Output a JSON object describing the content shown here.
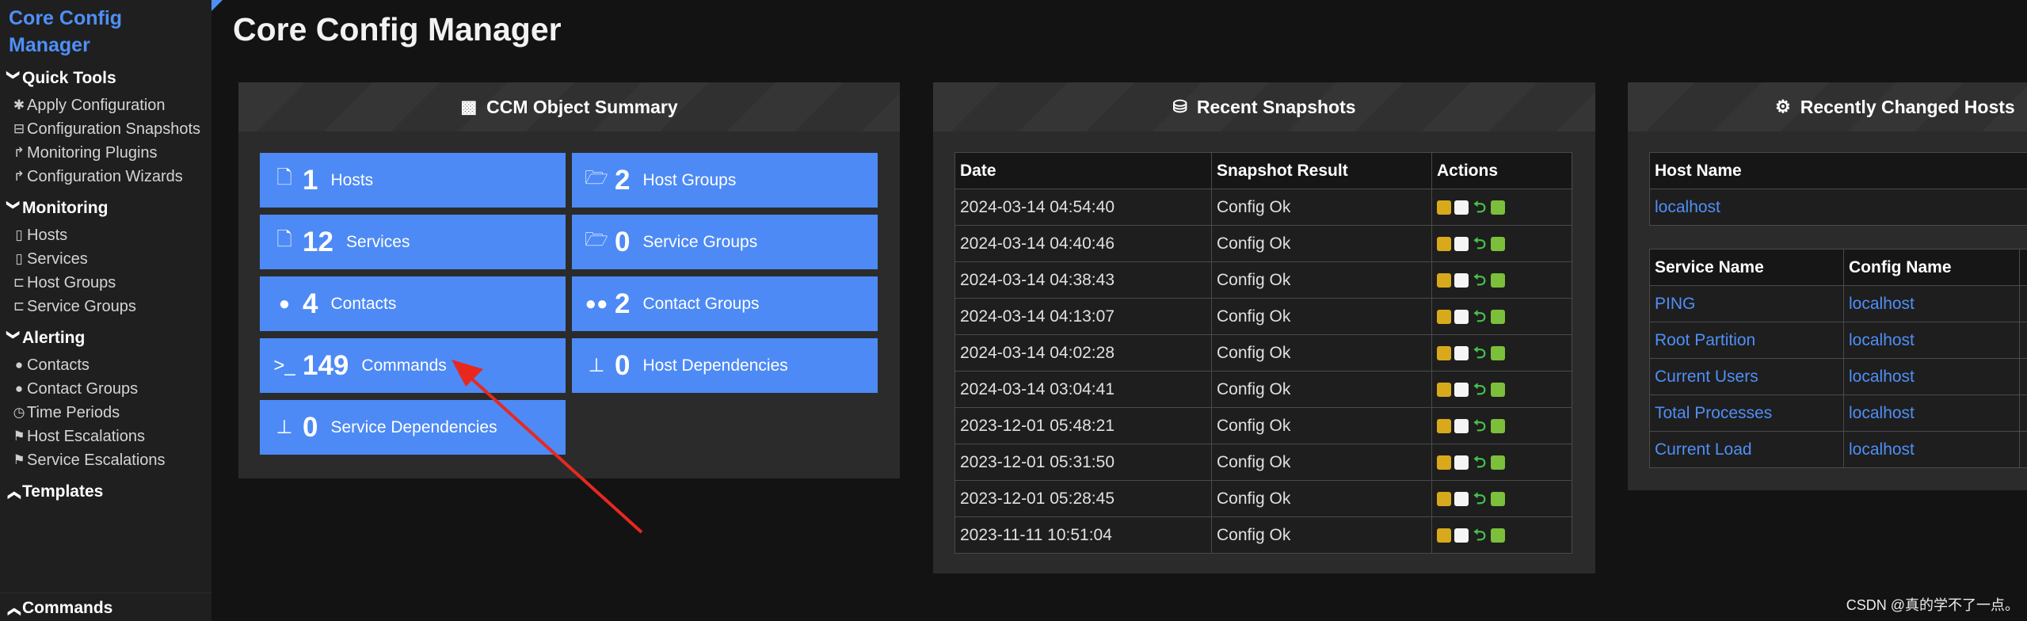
{
  "app": {
    "title_line1": "Core Config",
    "title_line2": "Manager"
  },
  "sidebar": {
    "quick_tools": {
      "label": "Quick Tools",
      "items": [
        {
          "icon": "gear-icon",
          "glyph": "✱",
          "label": "Apply Configuration"
        },
        {
          "icon": "camera-icon",
          "glyph": "⊟",
          "label": "Configuration Snapshots"
        },
        {
          "icon": "share-icon",
          "glyph": "↱",
          "label": "Monitoring Plugins"
        },
        {
          "icon": "share-icon",
          "glyph": "↱",
          "label": "Configuration Wizards"
        }
      ]
    },
    "monitoring": {
      "label": "Monitoring",
      "items": [
        {
          "icon": "file-icon",
          "glyph": "▯",
          "label": "Hosts"
        },
        {
          "icon": "file-icon",
          "glyph": "▯",
          "label": "Services"
        },
        {
          "icon": "folder-icon",
          "glyph": "⊏",
          "label": "Host Groups"
        },
        {
          "icon": "folder-icon",
          "glyph": "⊏",
          "label": "Service Groups"
        }
      ]
    },
    "alerting": {
      "label": "Alerting",
      "items": [
        {
          "icon": "user-icon",
          "glyph": "●",
          "label": "Contacts"
        },
        {
          "icon": "users-icon",
          "glyph": "●",
          "label": "Contact Groups"
        },
        {
          "icon": "clock-icon",
          "glyph": "◷",
          "label": "Time Periods"
        },
        {
          "icon": "flag-icon",
          "glyph": "⚑",
          "label": "Host Escalations"
        },
        {
          "icon": "flag-icon",
          "glyph": "⚑",
          "label": "Service Escalations"
        }
      ]
    },
    "templates": {
      "label": "Templates"
    },
    "commands": {
      "label": "Commands"
    }
  },
  "page": {
    "title": "Core Config Manager"
  },
  "summary": {
    "title": "CCM Object Summary",
    "tiles": [
      {
        "icon": "file-icon",
        "glyph": "🗋",
        "count": "1",
        "label": "Hosts"
      },
      {
        "icon": "folder-open-icon",
        "glyph": "🗁",
        "count": "2",
        "label": "Host Groups"
      },
      {
        "icon": "file-icon",
        "glyph": "🗋",
        "count": "12",
        "label": "Services"
      },
      {
        "icon": "folder-open-icon",
        "glyph": "🗁",
        "count": "0",
        "label": "Service Groups"
      },
      {
        "icon": "user-icon",
        "glyph": "●",
        "count": "4",
        "label": "Contacts"
      },
      {
        "icon": "users-icon",
        "glyph": "●●",
        "count": "2",
        "label": "Contact Groups"
      },
      {
        "icon": "terminal-icon",
        "glyph": ">_",
        "count": "149",
        "label": "Commands"
      },
      {
        "icon": "sitemap-icon",
        "glyph": "⊥",
        "count": "0",
        "label": "Host Dependencies"
      },
      {
        "icon": "sitemap-icon",
        "glyph": "⊥",
        "count": "0",
        "label": "Service Dependencies"
      }
    ]
  },
  "snapshots": {
    "title": "Recent Snapshots",
    "columns": [
      "Date",
      "Snapshot Result",
      "Actions"
    ],
    "rows": [
      {
        "date": "2024-03-14 04:54:40",
        "result": "Config Ok"
      },
      {
        "date": "2024-03-14 04:40:46",
        "result": "Config Ok"
      },
      {
        "date": "2024-03-14 04:38:43",
        "result": "Config Ok"
      },
      {
        "date": "2024-03-14 04:13:07",
        "result": "Config Ok"
      },
      {
        "date": "2024-03-14 04:02:28",
        "result": "Config Ok"
      },
      {
        "date": "2024-03-14 03:04:41",
        "result": "Config Ok"
      },
      {
        "date": "2023-12-01 05:48:21",
        "result": "Config Ok"
      },
      {
        "date": "2023-12-01 05:31:50",
        "result": "Config Ok"
      },
      {
        "date": "2023-12-01 05:28:45",
        "result": "Config Ok"
      },
      {
        "date": "2023-11-11 10:51:04",
        "result": "Config Ok"
      }
    ]
  },
  "changed": {
    "title": "Recently Changed Hosts",
    "host_column": "Host Name",
    "hosts": [
      "localhost"
    ],
    "service_columns": [
      "Service Name",
      "Config Name"
    ],
    "services": [
      {
        "name": "PING",
        "config": "localhost"
      },
      {
        "name": "Root Partition",
        "config": "localhost"
      },
      {
        "name": "Current Users",
        "config": "localhost"
      },
      {
        "name": "Total Processes",
        "config": "localhost"
      },
      {
        "name": "Current Load",
        "config": "localhost"
      }
    ]
  },
  "watermark": "CSDN @真的学不了一点。",
  "colors": {
    "accent": "#4f8ff7",
    "tile": "#4d8af5",
    "arrow": "#e8281f"
  }
}
